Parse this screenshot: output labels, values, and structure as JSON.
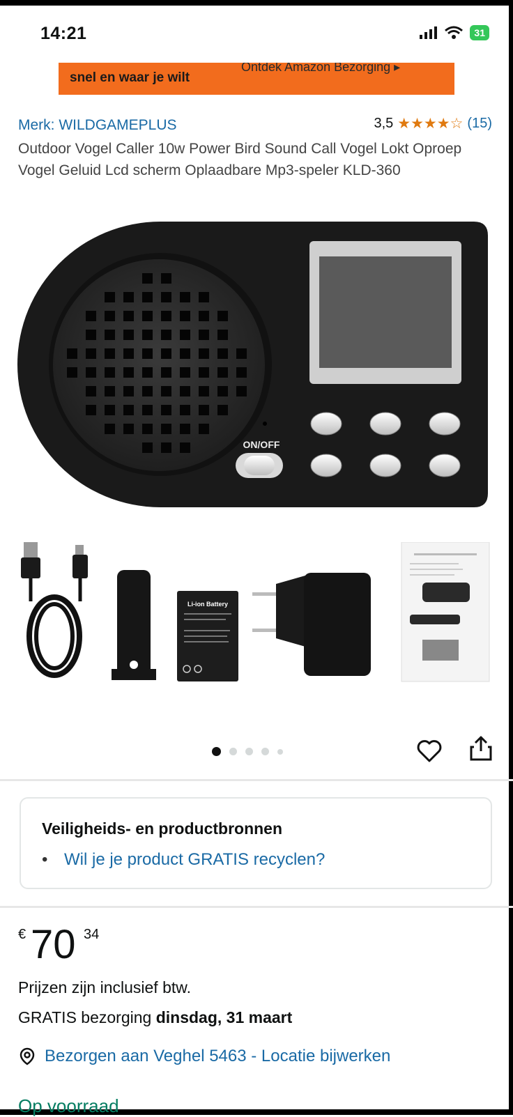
{
  "status_bar": {
    "time": "14:21",
    "battery": "31"
  },
  "banner": {
    "left_text": "snel en waar je wilt",
    "right_text": "Ontdek Amazon Bezorging ▸"
  },
  "product": {
    "brand": "Merk: WILDGAMEPLUS",
    "rating_value": "3,5",
    "rating_stars": "★★★★☆",
    "rating_count": "(15)",
    "title": "Outdoor Vogel Caller 10w Power Bird Sound Call Vogel Lokt Oproep Vogel Geluid Lcd scherm Oplaadbare Mp3-speler KLD-360",
    "device_switch_label": "ON/OFF",
    "battery_label": "Li-ion Battery"
  },
  "carousel": {
    "total": 5,
    "active": 0
  },
  "safety": {
    "title": "Veiligheids- en productbronnen",
    "bullet": "•",
    "link": "Wil je je product GRATIS recyclen?"
  },
  "price": {
    "currency": "€",
    "whole": "70",
    "fraction": "34"
  },
  "price_note": "Prijzen zijn inclusief btw.",
  "delivery": {
    "prefix": "GRATIS bezorging ",
    "date": "dinsdag, 31 maart"
  },
  "location": {
    "text": "Bezorgen aan Veghel 5463 - Locatie bijwerken"
  },
  "stock": "Op voorraad",
  "colors": {
    "link": "#1a6aa5",
    "banner": "#f26c1d",
    "star": "#e07a10",
    "stock": "#067d62"
  }
}
